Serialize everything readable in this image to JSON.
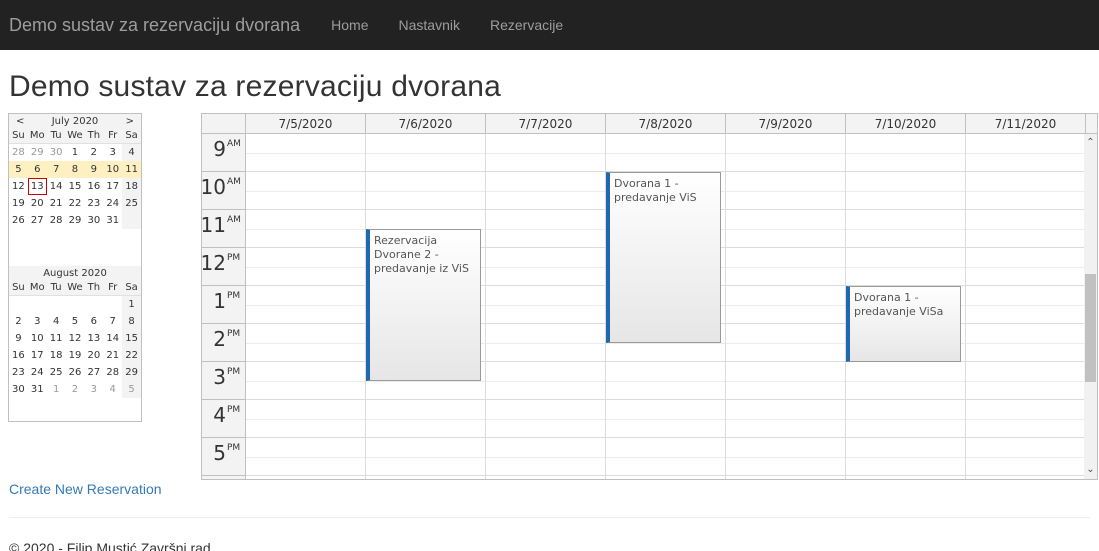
{
  "navbar": {
    "brand": "Demo sustav za rezervaciju dvorana",
    "links": [
      "Home",
      "Nastavnik",
      "Rezervacije"
    ]
  },
  "page_title": "Demo sustav za rezervaciju dvorana",
  "navigator": {
    "prev": "<",
    "next": ">",
    "dow": [
      "Su",
      "Mo",
      "Tu",
      "We",
      "Th",
      "Fr",
      "Sa"
    ],
    "months": [
      {
        "title": "July 2020",
        "weeks": [
          [
            "28",
            "29",
            "30",
            "1",
            "2",
            "3",
            "4"
          ],
          [
            "5",
            "6",
            "7",
            "8",
            "9",
            "10",
            "11"
          ],
          [
            "12",
            "13",
            "14",
            "15",
            "16",
            "17",
            "18"
          ],
          [
            "19",
            "20",
            "21",
            "22",
            "23",
            "24",
            "25"
          ],
          [
            "26",
            "27",
            "28",
            "29",
            "30",
            "31",
            ""
          ]
        ]
      },
      {
        "title": "August 2020",
        "weeks": [
          [
            "",
            "",
            "",
            "",
            "",
            "",
            "1"
          ],
          [
            "2",
            "3",
            "4",
            "5",
            "6",
            "7",
            "8"
          ],
          [
            "9",
            "10",
            "11",
            "12",
            "13",
            "14",
            "15"
          ],
          [
            "16",
            "17",
            "18",
            "19",
            "20",
            "21",
            "22"
          ],
          [
            "23",
            "24",
            "25",
            "26",
            "27",
            "28",
            "29"
          ],
          [
            "30",
            "31",
            "1",
            "2",
            "3",
            "4",
            "5"
          ]
        ]
      }
    ]
  },
  "calendar": {
    "days": [
      "7/5/2020",
      "7/6/2020",
      "7/7/2020",
      "7/8/2020",
      "7/9/2020",
      "7/10/2020",
      "7/11/2020"
    ],
    "hours": [
      {
        "n": "9",
        "s": "AM"
      },
      {
        "n": "10",
        "s": "AM"
      },
      {
        "n": "11",
        "s": "AM"
      },
      {
        "n": "12",
        "s": "PM"
      },
      {
        "n": "1",
        "s": "PM"
      },
      {
        "n": "2",
        "s": "PM"
      },
      {
        "n": "3",
        "s": "PM"
      },
      {
        "n": "4",
        "s": "PM"
      },
      {
        "n": "5",
        "s": "PM"
      }
    ],
    "events": [
      {
        "text": "Rezervacija Dvorane 2 - predavanje iz ViS",
        "day": "7/6/2020",
        "start": "11:30",
        "end": "15:30",
        "color": "#1e68b0"
      },
      {
        "text": "Dvorana 1 - predavanje ViS",
        "day": "7/8/2020",
        "start": "10:00",
        "end": "14:30",
        "color": "#1e68b0"
      },
      {
        "text": "Dvorana 1 - predavanje ViSa",
        "day": "7/10/2020",
        "start": "13:00",
        "end": "15:00",
        "color": "#1e68b0"
      }
    ]
  },
  "create_link": "Create New Reservation",
  "footer": "© 2020 - Filip Mustić Završni rad"
}
